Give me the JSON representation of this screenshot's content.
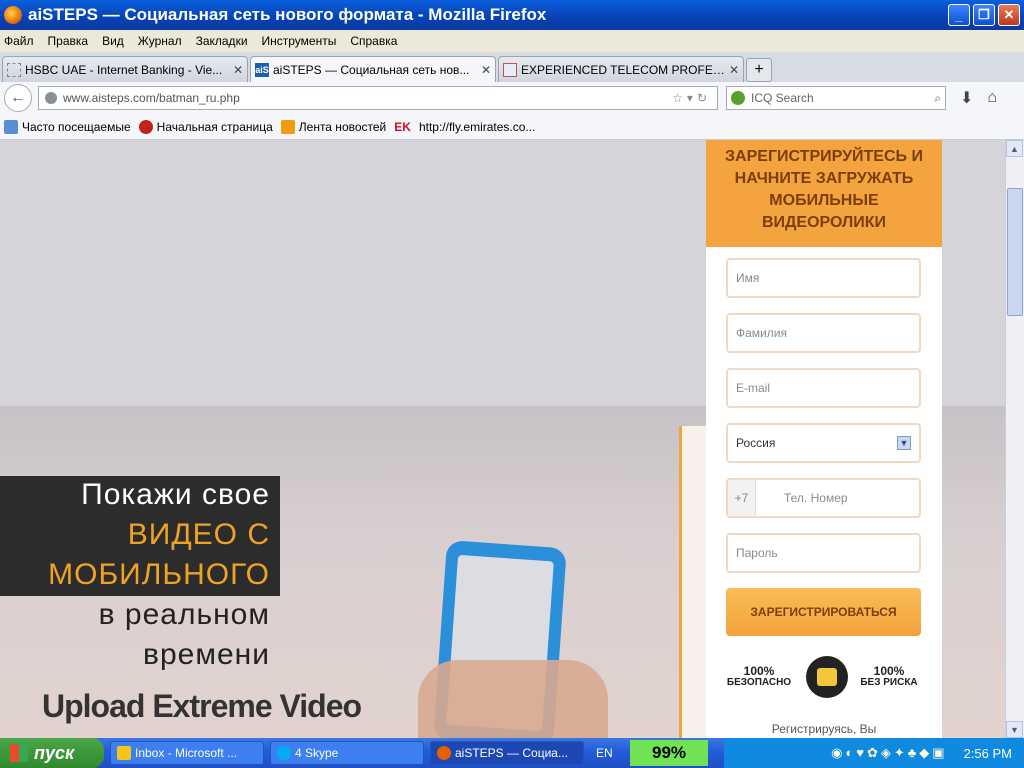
{
  "window": {
    "title": "aiSTEPS — Социальная сеть нового формата - Mozilla Firefox"
  },
  "menu": [
    "Файл",
    "Правка",
    "Вид",
    "Журнал",
    "Закладки",
    "Инструменты",
    "Справка"
  ],
  "tabs": [
    {
      "label": "HSBC UAE - Internet Banking - Vie...",
      "favicon": "blank-page-icon",
      "active": false
    },
    {
      "label": "aiSTEPS — Социальная сеть нов...",
      "favicon": "aisteps-icon",
      "active": true
    },
    {
      "label": "EXPERIENCED TELECOM PROFESS...",
      "favicon": "fb-icon",
      "active": false
    }
  ],
  "nav": {
    "url": "www.aisteps.com/batman_ru.php",
    "search_placeholder": "ICQ Search"
  },
  "bookmarks": [
    {
      "label": "Часто посещаемые",
      "icon": "bookmark-folder-icon"
    },
    {
      "label": "Начальная страница",
      "icon": "red-bird-icon"
    },
    {
      "label": "Лента новостей",
      "icon": "rss-icon"
    },
    {
      "label": "http://fly.emirates.co...",
      "icon": "emirates-logo-icon",
      "badge": "EK"
    }
  ],
  "hero": {
    "line1": "Покажи свое",
    "line2": "ВИДЕО С",
    "line3": "МОБИЛЬНОГО",
    "line4": "в реальном",
    "line5": "времени",
    "upload": "Upload Extreme Video"
  },
  "form": {
    "heading": "ЗАРЕГИСТРИРУЙТЕСЬ И НАЧНИТЕ ЗАГРУЖАТЬ МОБИЛЬНЫЕ ВИДЕОРОЛИКИ",
    "first_name": "Имя",
    "last_name": "Фамилия",
    "email": "E-mail",
    "country": "Россия",
    "phone_prefix": "+7",
    "phone": "Тел. Номер",
    "password": "Пароль",
    "submit": "ЗАРЕГИСТРИРОВАТЬСЯ",
    "safe_pct": "100%",
    "safe": "БЕЗОПАСНО",
    "risk_pct": "100%",
    "risk": "БЕЗ РИСКА",
    "footnote": "Регистрируясь, Вы"
  },
  "colors": {
    "accent": "#f4a43e",
    "titlebar": "#0a5fdc",
    "highlight": "#f0a322"
  },
  "taskbar": {
    "start": "пуск",
    "items": [
      {
        "label": "Inbox - Microsoft ...",
        "icon": "outlook-icon"
      },
      {
        "label": "4 Skype",
        "icon": "skype-icon"
      },
      {
        "label": "aiSTEPS — Социа...",
        "icon": "firefox-icon"
      },
      {
        "label": "EN",
        "icon": ""
      }
    ],
    "meter": "99%",
    "clock": "2:56 PM"
  }
}
